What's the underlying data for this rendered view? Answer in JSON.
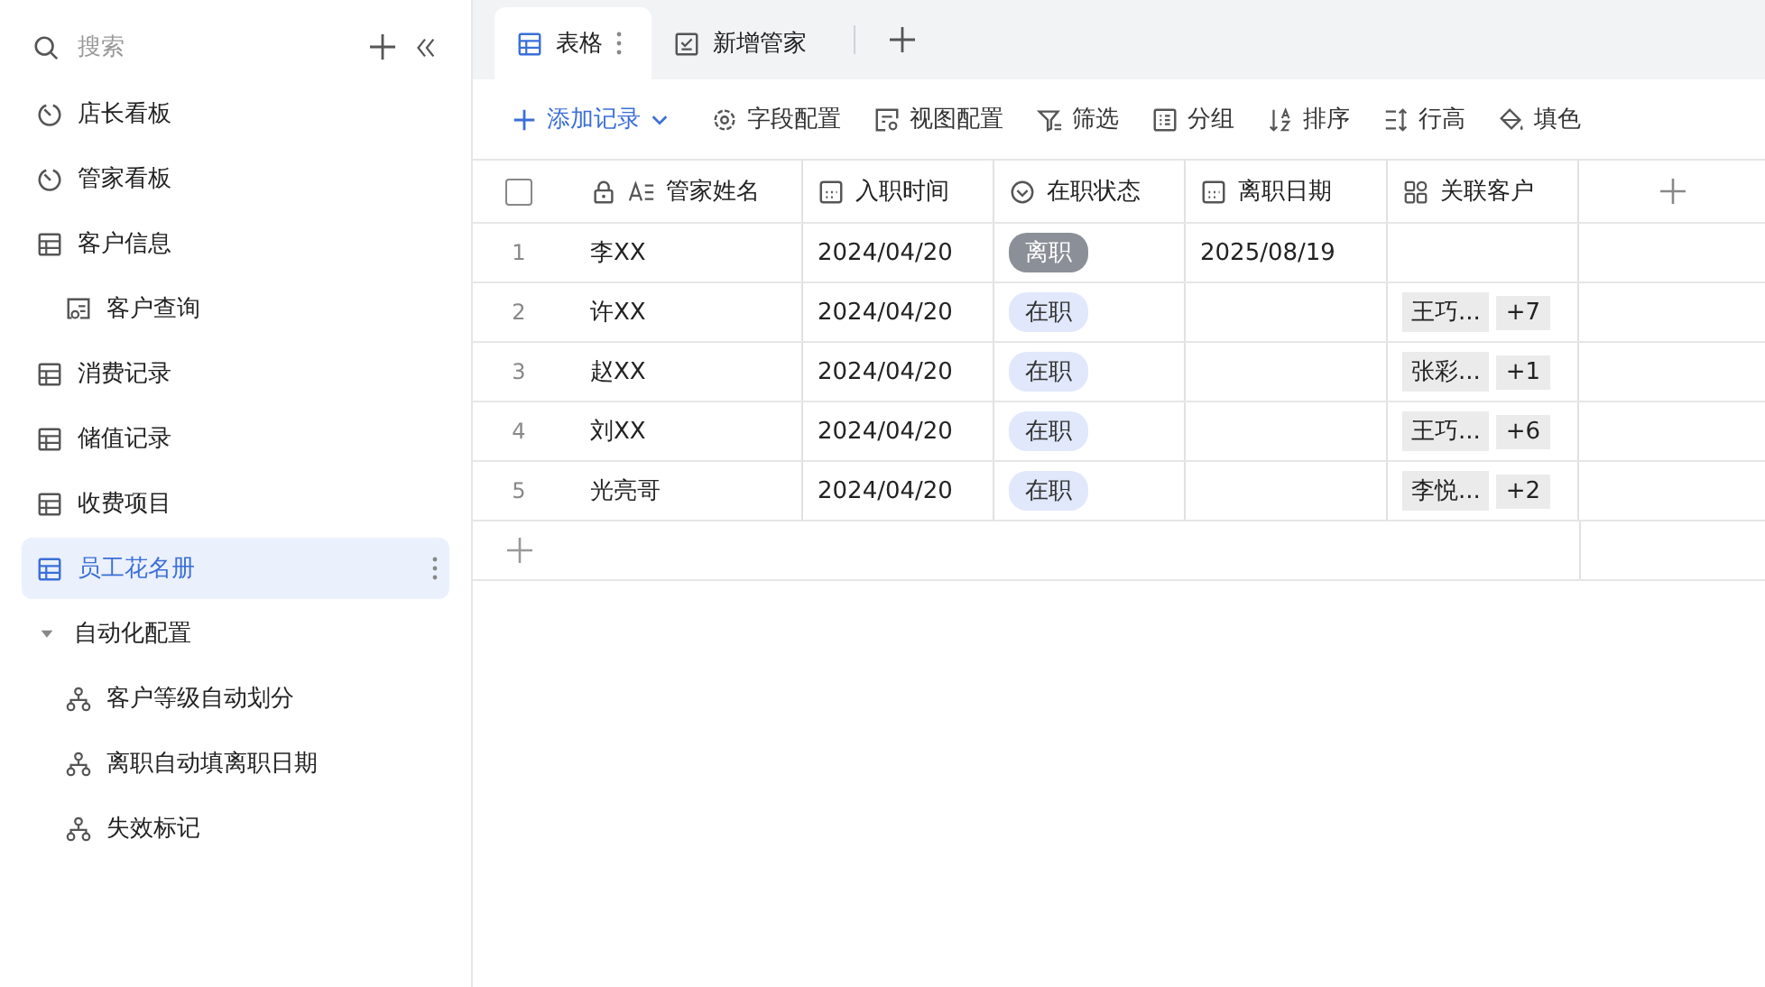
{
  "sidebar": {
    "search": {
      "placeholder": "搜索"
    },
    "items": [
      {
        "label": "店长看板",
        "kind": "dashboard",
        "selected": false
      },
      {
        "label": "管家看板",
        "kind": "dashboard",
        "selected": false
      },
      {
        "label": "客户信息",
        "kind": "table",
        "selected": false,
        "children": [
          {
            "label": "客户查询",
            "kind": "form",
            "selected": false
          }
        ]
      },
      {
        "label": "消费记录",
        "kind": "table",
        "selected": false
      },
      {
        "label": "储值记录",
        "kind": "table",
        "selected": false
      },
      {
        "label": "收费项目",
        "kind": "table",
        "selected": false
      },
      {
        "label": "员工花名册",
        "kind": "table",
        "selected": true
      },
      {
        "label": "自动化配置",
        "kind": "folder",
        "selected": false,
        "expanded": true,
        "children": [
          {
            "label": "客户等级自动划分",
            "kind": "automation",
            "selected": false
          },
          {
            "label": "离职自动填离职日期",
            "kind": "automation",
            "selected": false
          },
          {
            "label": "失效标记",
            "kind": "automation",
            "selected": false
          }
        ]
      }
    ]
  },
  "tabs": [
    {
      "label": "表格",
      "kind": "grid",
      "selected": true
    },
    {
      "label": "新增管家",
      "kind": "form",
      "selected": false
    }
  ],
  "toolbar": {
    "add": "添加记录",
    "tools": [
      {
        "label": "字段配置",
        "kind": "gear"
      },
      {
        "label": "视图配置",
        "kind": "view"
      },
      {
        "label": "筛选",
        "kind": "filter"
      },
      {
        "label": "分组",
        "kind": "group"
      },
      {
        "label": "排序",
        "kind": "sort"
      },
      {
        "label": "行高",
        "kind": "height"
      },
      {
        "label": "填色",
        "kind": "fill"
      }
    ]
  },
  "table": {
    "select_all": {
      "checked": false
    },
    "columns": [
      {
        "label": "管家姓名",
        "kind": "text",
        "locked": true
      },
      {
        "label": "入职时间",
        "kind": "date"
      },
      {
        "label": "在职状态",
        "kind": "status"
      },
      {
        "label": "离职日期",
        "kind": "date"
      },
      {
        "label": "关联客户",
        "kind": "link"
      }
    ],
    "rows": [
      {
        "index": "1",
        "name": "李XX",
        "start": "2024/04/20",
        "status": {
          "label": "离职",
          "color": "#8b8f97"
        },
        "end": "2025/08/19"
      },
      {
        "index": "2",
        "name": "许XX",
        "start": "2024/04/20",
        "status": {
          "label": "在职",
          "color": "#e1e8fb"
        },
        "link": {
          "first": "王巧...",
          "more": "+7"
        }
      },
      {
        "index": "3",
        "name": "赵XX",
        "start": "2024/04/20",
        "status": {
          "label": "在职",
          "color": "#e1e8fb"
        },
        "link": {
          "first": "张彩...",
          "more": "+1"
        }
      },
      {
        "index": "4",
        "name": "刘XX",
        "start": "2024/04/20",
        "status": {
          "label": "在职",
          "color": "#e1e8fb"
        },
        "link": {
          "first": "王巧...",
          "more": "+6"
        }
      },
      {
        "index": "5",
        "name": "光亮哥",
        "start": "2024/04/20",
        "status": {
          "label": "在职",
          "color": "#e1e8fb"
        },
        "link": {
          "first": "李悦...",
          "more": "+2"
        }
      }
    ]
  }
}
